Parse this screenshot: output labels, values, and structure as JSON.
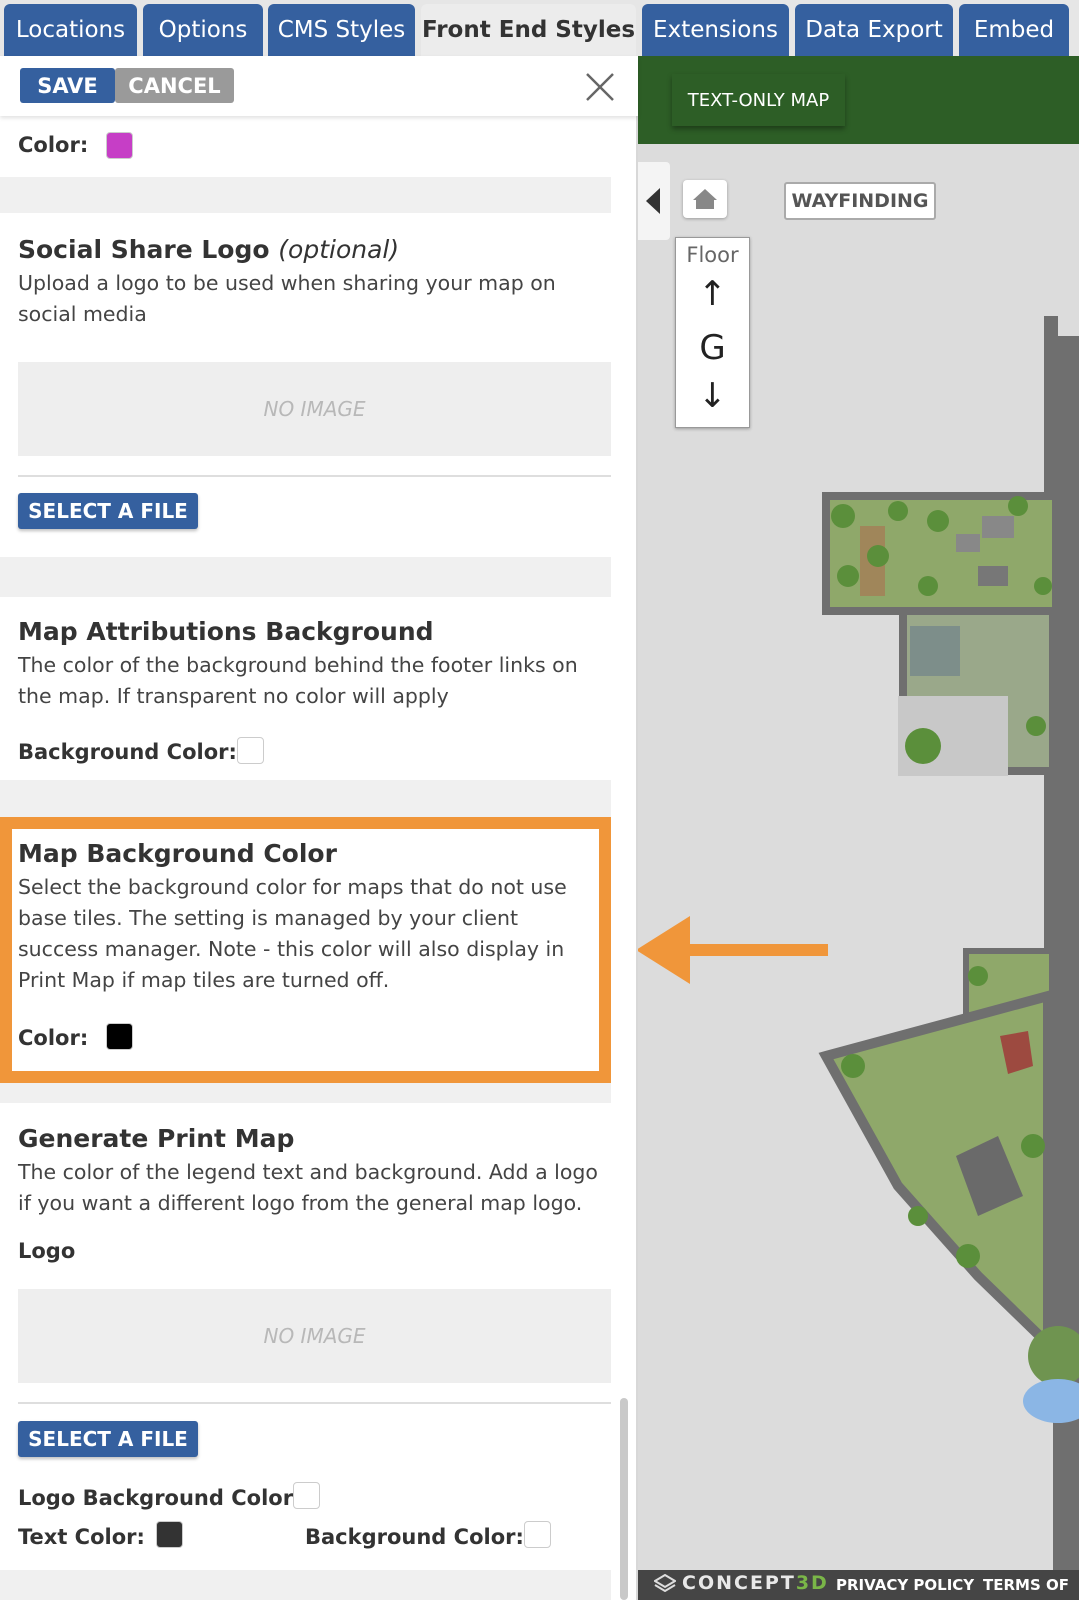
{
  "tabs": [
    {
      "label": "Locations",
      "active": false
    },
    {
      "label": "Options",
      "active": false
    },
    {
      "label": "CMS Styles",
      "active": false
    },
    {
      "label": "Front End Styles",
      "active": true
    },
    {
      "label": "Extensions",
      "active": false
    },
    {
      "label": "Data Export",
      "active": false
    },
    {
      "label": "Embed",
      "active": false
    }
  ],
  "toolbar": {
    "save_label": "SAVE",
    "cancel_label": "CANCEL"
  },
  "top_color": {
    "label": "Color:",
    "value": "#c63ec6"
  },
  "social_share": {
    "title": "Social Share Logo",
    "optional": "(optional)",
    "description": "Upload a logo to be used when sharing your map on social media",
    "no_image": "NO IMAGE",
    "select_file": "SELECT A FILE"
  },
  "attributions": {
    "title": "Map Attributions Background",
    "description": "The color of the background behind the footer links on the map. If transparent no color will apply",
    "bg_label": "Background Color:"
  },
  "map_bg": {
    "title": "Map Background Color",
    "description": "Select the background color for maps that do not use base tiles. The setting is managed by your client success manager. Note - this color will also display in Print Map if map tiles are turned off.",
    "color_label": "Color:",
    "color_value": "#000000",
    "highlight_color": "#f0963a"
  },
  "print_map": {
    "title": "Generate Print Map",
    "description": "The color of the legend text and background. Add a logo if you want a different logo from the general map logo.",
    "logo_label": "Logo",
    "no_image": "NO IMAGE",
    "select_file": "SELECT A FILE",
    "logo_bg_label": "Logo Background Color:",
    "text_color_label": "Text Color:",
    "text_color_value": "#333333",
    "bg_color_label": "Background Color:"
  },
  "map": {
    "text_only": "TEXT-ONLY MAP",
    "wayfinding": "WAYFINDING",
    "floor_label": "Floor",
    "floor_up": "↑",
    "floor_current": "G",
    "floor_down": "↓",
    "header_color": "#2d5e26",
    "icons": [
      "collapse-arrow-icon",
      "home-icon",
      "close-icon",
      "concept3d-logo-icon"
    ]
  },
  "footer": {
    "brand": "CONCEPT",
    "brand_suffix": "3D",
    "privacy": "PRIVACY POLICY",
    "terms": "TERMS OF"
  }
}
